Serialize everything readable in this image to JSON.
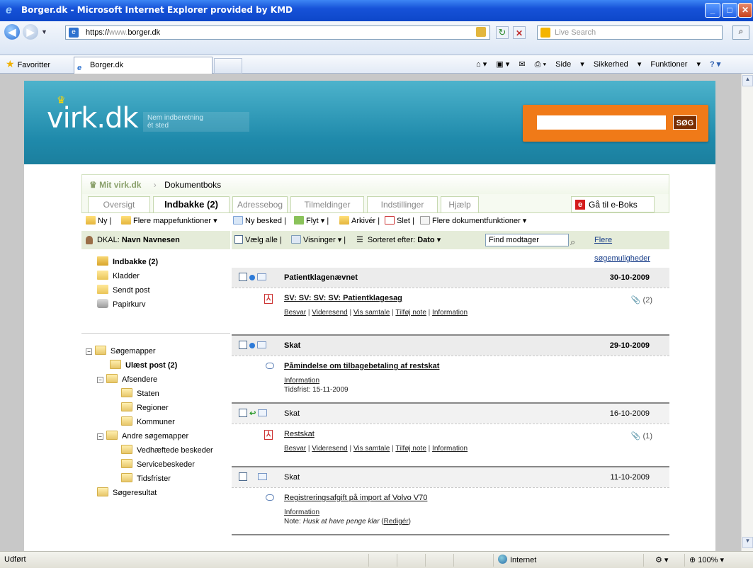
{
  "window": {
    "title": "Borger.dk - Microsoft Internet Explorer provided by KMD"
  },
  "browser": {
    "url_prefix": "https://",
    "url_gray": "www.",
    "url_host": "borger.dk",
    "search_placeholder": "Live Search",
    "favorites_label": "Favoritter",
    "tab_title": "Borger.dk",
    "cmd_side": "Side",
    "cmd_security": "Sikkerhed",
    "cmd_functions": "Funktioner"
  },
  "site": {
    "logo": "virk.dk",
    "tagline_1": "Nem indberetning",
    "tagline_2": "ét sted",
    "search_button": "SØG",
    "breadcrumb_root": "Mit virk.dk",
    "breadcrumb_current": "Dokumentboks",
    "tabs": [
      {
        "label": "Oversigt"
      },
      {
        "label": "Indbakke (2)"
      },
      {
        "label": "Adressebog"
      },
      {
        "label": "Tilmeldinger"
      },
      {
        "label": "Indstillinger"
      },
      {
        "label": "Hjælp"
      }
    ],
    "eboks_label": "Gå til e-Boks"
  },
  "toolbar": {
    "new": "Ny",
    "more_folder": "Flere mappefunktioner",
    "new_message": "Ny besked",
    "move": "Flyt",
    "archive": "Arkivér",
    "delete": "Slet",
    "more_doc": "Flere dokumentfunktioner"
  },
  "user": {
    "label": "DKAL:",
    "name": "Navn Navnesen"
  },
  "filter": {
    "select_all": "Vælg alle",
    "views": "Visninger",
    "sorted_by": "Sorteret efter:",
    "sort_value": "Dato",
    "find_placeholder": "Find modtager",
    "more_search": "Flere søgemuligheder"
  },
  "folders": {
    "inbox": "Indbakke (2)",
    "drafts": "Kladder",
    "sent": "Sendt post",
    "trash": "Papirkurv",
    "search_folders": "Søgemapper",
    "unread": "Ulæst post (2)",
    "senders": "Afsendere",
    "state": "Staten",
    "regions": "Regioner",
    "municipalities": "Kommuner",
    "other_search": "Andre søgemapper",
    "attached": "Vedhæftede beskeder",
    "service": "Servicebeskeder",
    "deadlines": "Tidsfrister",
    "search_result": "Søgeresultat"
  },
  "messages": [
    {
      "from": "Patientklagenævnet",
      "date": "30-10-2009",
      "subject": "SV: SV: SV: SV: Patientklagesag",
      "attachments": "(2)",
      "unread": true
    },
    {
      "from": "Skat",
      "date": "29-10-2009",
      "subject": "Påmindelse om tilbagebetaling af restskat",
      "deadline": "Tidsfrist: 15-11-2009",
      "unread": true
    },
    {
      "from": "Skat",
      "date": "16-10-2009",
      "subject": "Restskat",
      "attachments": "(1)",
      "unread": false
    },
    {
      "from": "Skat",
      "date": "11-10-2009",
      "subject": "Registreringsafgift på import af Volvo V70",
      "note_label": "Note:",
      "note_text": "Husk at have penge klar",
      "note_edit": "Redigér",
      "unread": false
    }
  ],
  "actions": {
    "reply": "Besvar",
    "forward": "Videresend",
    "conversation": "Vis samtale",
    "add_note": "Tilføj note",
    "information": "Information"
  },
  "status": {
    "left": "Udført",
    "zone": "Internet",
    "zoom": "100%"
  }
}
